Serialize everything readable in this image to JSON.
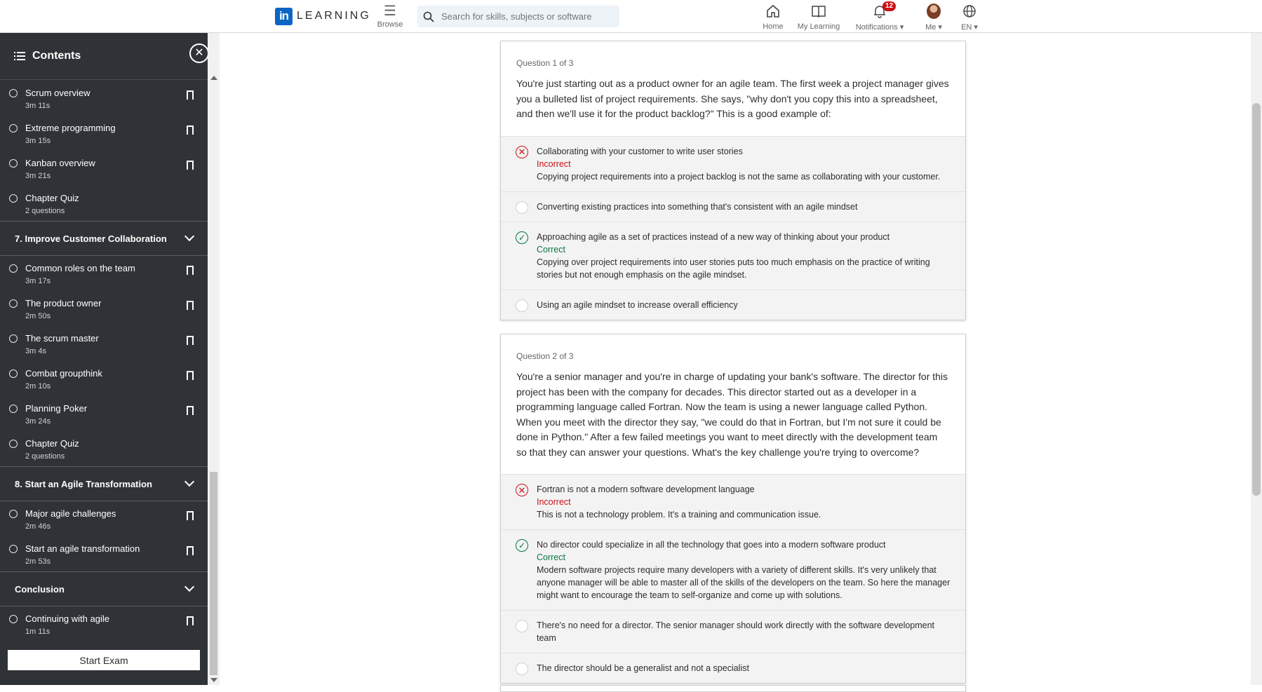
{
  "nav": {
    "logo_in": "in",
    "logo_text": "LEARNING",
    "browse": "Browse",
    "search_placeholder": "Search for skills, subjects or software",
    "home": "Home",
    "my_learning": "My Learning",
    "notifications": "Notifications",
    "notifications_count": "12",
    "me": "Me",
    "language": "EN"
  },
  "sidebar": {
    "title": "Contents",
    "start_exam": "Start Exam",
    "entries": [
      {
        "kind": "item",
        "name": "Scrum overview",
        "dur": "3m 11s"
      },
      {
        "kind": "item",
        "name": "Extreme programming",
        "dur": "3m 15s"
      },
      {
        "kind": "item",
        "name": "Kanban overview",
        "dur": "3m 21s"
      },
      {
        "kind": "quiz",
        "name": "Chapter Quiz",
        "dur": "2 questions"
      },
      {
        "kind": "chapter",
        "name": "7. Improve Customer Collaboration"
      },
      {
        "kind": "item",
        "name": "Common roles on the team",
        "dur": "3m 17s"
      },
      {
        "kind": "item",
        "name": "The product owner",
        "dur": "2m 50s"
      },
      {
        "kind": "item",
        "name": "The scrum master",
        "dur": "3m 4s"
      },
      {
        "kind": "item",
        "name": "Combat groupthink",
        "dur": "2m 10s"
      },
      {
        "kind": "item",
        "name": "Planning Poker",
        "dur": "3m 24s"
      },
      {
        "kind": "quiz",
        "name": "Chapter Quiz",
        "dur": "2 questions"
      },
      {
        "kind": "chapter",
        "name": "8. Start an Agile Transformation"
      },
      {
        "kind": "item",
        "name": "Major agile challenges",
        "dur": "2m 46s"
      },
      {
        "kind": "item",
        "name": "Start an agile transformation",
        "dur": "2m 53s"
      },
      {
        "kind": "chapter",
        "name": "Conclusion"
      },
      {
        "kind": "item",
        "name": "Continuing with agile",
        "dur": "1m 11s"
      }
    ]
  },
  "questions": [
    {
      "number": "Question 1 of 3",
      "text": "You're just starting out as a product owner for an agile team. The first week a project manager gives you a bulleted list of project requirements. She says, \"why don't you copy this into a spreadsheet, and then we'll use it for the product backlog?\" This is a good example of:",
      "options": [
        {
          "text": "Collaborating with your customer to write user stories",
          "state": "wrong",
          "status": "Incorrect",
          "explanation": "Copying project requirements into a project backlog is not the same as collaborating with your customer."
        },
        {
          "text": "Converting existing practices into something that's consistent with an agile mindset",
          "state": "none"
        },
        {
          "text": "Approaching agile as a set of practices instead of a new way of thinking about your product",
          "state": "right",
          "status": "Correct",
          "explanation": "Copying over project requirements into user stories puts too much emphasis on the practice of writing stories but not enough emphasis on the agile mindset."
        },
        {
          "text": "Using an agile mindset to increase overall efficiency",
          "state": "none"
        }
      ]
    },
    {
      "number": "Question 2 of 3",
      "text": "You're a senior manager and you're in charge of updating your bank's software. The director for this project has been with the company for decades. This director started out as a developer in a programming language called Fortran. Now the team is using a newer language called Python. When you meet with the director they say, \"we could do that in Fortran, but I'm not sure it could be done in Python.\" After a few failed meetings you want to meet directly with the development team so that they can answer your questions. What's the key challenge you're trying to overcome?",
      "options": [
        {
          "text": "Fortran is not a modern software development language",
          "state": "wrong",
          "status": "Incorrect",
          "explanation": "This is not a technology problem. It's a training and communication issue."
        },
        {
          "text": "No director could specialize in all the technology that goes into a modern software product",
          "state": "right",
          "status": "Correct",
          "explanation": "Modern software projects require many developers with a variety of different skills. It's very unlikely that anyone manager will be able to master all of the skills of the developers on the team. So here the manager might want to encourage the team to self-organize and come up with solutions."
        },
        {
          "text": "There's no need for a director. The senior manager should work directly with the software development team",
          "state": "none"
        },
        {
          "text": "The director should be a generalist and not a specialist",
          "state": "none"
        }
      ]
    }
  ]
}
